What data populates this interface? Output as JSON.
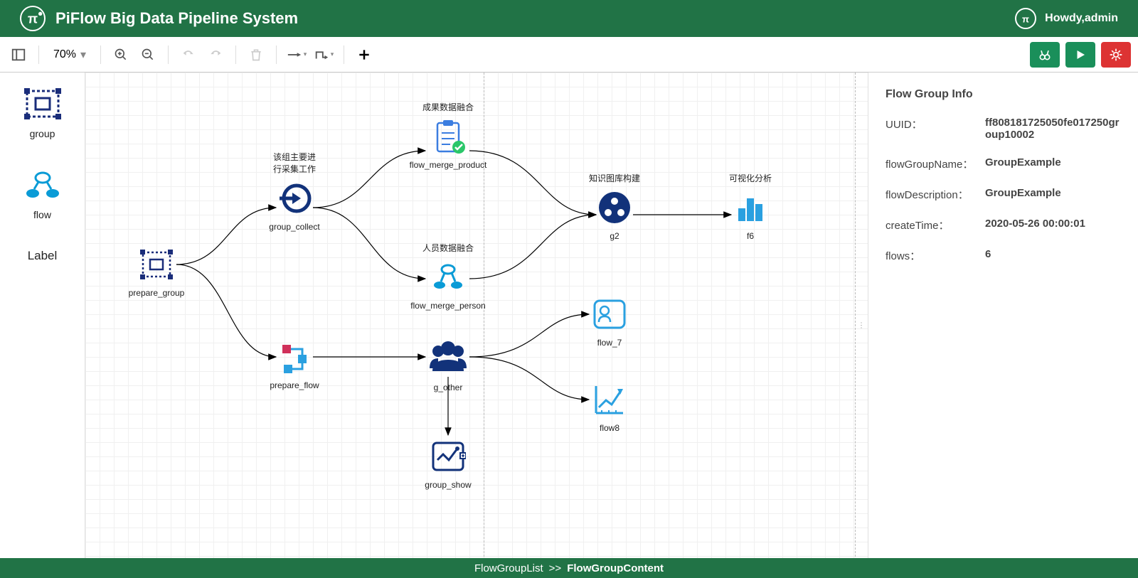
{
  "header": {
    "title": "PiFlow Big Data Pipeline System",
    "greeting": "Howdy,admin"
  },
  "toolbar": {
    "zoom": "70%",
    "buttons": {
      "layout": "layout",
      "zoom_in": "zoom-in",
      "zoom_out": "zoom-out",
      "undo": "undo",
      "redo": "redo",
      "delete": "delete",
      "arrow_right": "arrow-right",
      "orthogonal": "orthogonal",
      "add": "add"
    },
    "actions": {
      "search": "search",
      "run": "run",
      "settings": "settings"
    }
  },
  "palette": {
    "group": "group",
    "flow": "flow",
    "label": "Label"
  },
  "nodes": {
    "prepare_group": {
      "label": "prepare_group"
    },
    "group_collect": {
      "label": "group_collect",
      "annotation": "该组主要进\n行采集工作"
    },
    "prepare_flow": {
      "label": "prepare_flow"
    },
    "flow_merge_product": {
      "label": "flow_merge_product",
      "annotation": "成果数据融合"
    },
    "flow_merge_person": {
      "label": "flow_merge_person",
      "annotation": "人员数据融合"
    },
    "g_other": {
      "label": "g_other"
    },
    "group_show": {
      "label": "group_show"
    },
    "g2": {
      "label": "g2",
      "annotation": "知识图库构建"
    },
    "f6": {
      "label": "f6",
      "annotation": "可视化分析"
    },
    "flow_7": {
      "label": "flow_7"
    },
    "flow8": {
      "label": "flow8"
    }
  },
  "info": {
    "title": "Flow Group Info",
    "fields": {
      "uuid_key": "UUID：",
      "uuid": "ff808181725050fe017250group10002",
      "name_key": "flowGroupName：",
      "name": "GroupExample",
      "desc_key": "flowDescription：",
      "desc": "GroupExample",
      "time_key": "createTime：",
      "time": "2020-05-26 00:00:01",
      "flows_key": "flows：",
      "flows": "6"
    }
  },
  "footer": {
    "crumb1": "FlowGroupList",
    "sep": ">>",
    "crumb2": "FlowGroupContent"
  }
}
